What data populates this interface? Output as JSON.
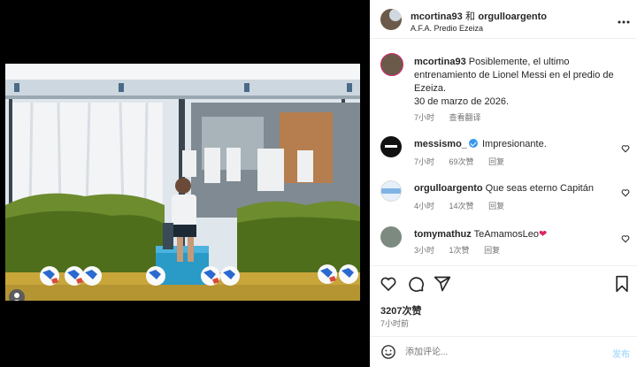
{
  "post": {
    "author": "mcortina93",
    "joiner": "和",
    "coauthor": "orgulloargento",
    "location": "A.F.A. Predio Ezeiza",
    "caption_user": "mcortina93",
    "caption_text": "Posiblemente, el ultimo entrenamiento de Lionel Messi en el predio de Ezeiza.",
    "caption_date": "30 de marzo de 2026.",
    "caption_time": "7小时",
    "see_translation": "查看翻译"
  },
  "comments": [
    {
      "user": "messismo_",
      "verified": true,
      "text": "Impresionante.",
      "time": "7小时",
      "likes": "69次赞",
      "reply": "回复"
    },
    {
      "user": "orgulloargento",
      "verified": false,
      "text": "Que seas eterno Capitán",
      "time": "4小时",
      "likes": "14次赞",
      "reply": "回复"
    },
    {
      "user": "tomymathuz",
      "verified": false,
      "text": "TeAmamosLeo",
      "emoji": "❤",
      "time": "3小时",
      "likes": "1次赞",
      "reply": "回复"
    }
  ],
  "footer": {
    "likes": "3207次赞",
    "time": "7小时前",
    "comment_placeholder": "添加评论...",
    "post_button": "发布"
  },
  "icons": [
    "heart-icon",
    "comment-icon",
    "share-icon",
    "bookmark-icon",
    "emoji-icon",
    "more-icon",
    "verified-icon",
    "user-tag-icon"
  ],
  "colors": {
    "verified": "#3897f0",
    "heart_emoji": "#e0245e",
    "post_button": "#b2dffc",
    "muted": "#737373"
  }
}
